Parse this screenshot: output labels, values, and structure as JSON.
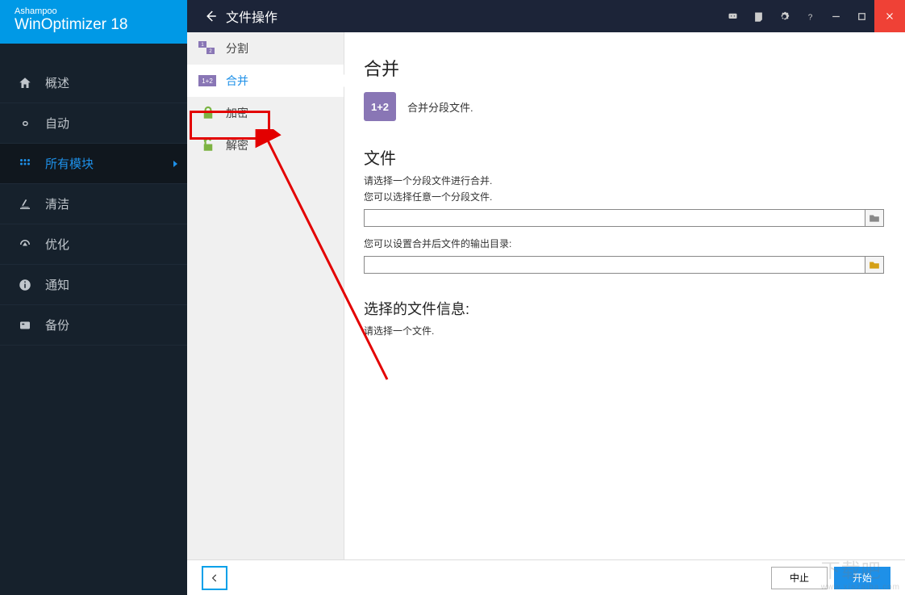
{
  "brand": {
    "small": "Ashampoo",
    "big": "WinOptimizer 18"
  },
  "titlebar": {
    "title": "文件操作"
  },
  "nav": [
    {
      "id": "overview",
      "label": "概述"
    },
    {
      "id": "auto",
      "label": "自动"
    },
    {
      "id": "modules",
      "label": "所有模块",
      "active": true
    },
    {
      "id": "clean",
      "label": "清洁"
    },
    {
      "id": "optimize",
      "label": "优化"
    },
    {
      "id": "notify",
      "label": "通知"
    },
    {
      "id": "backup",
      "label": "备份"
    }
  ],
  "subnav": [
    {
      "id": "split",
      "label": "分割"
    },
    {
      "id": "merge",
      "label": "合并",
      "selected": true
    },
    {
      "id": "encrypt",
      "label": "加密"
    },
    {
      "id": "decrypt",
      "label": "解密"
    }
  ],
  "main": {
    "heading": "合并",
    "badge": "1+2",
    "desc": "合并分段文件.",
    "file_section": "文件",
    "hint1": "请选择一个分段文件进行合并.",
    "hint2": "您可以选择任意一个分段文件.",
    "out_hint": "您可以设置合并后文件的输出目录:",
    "file_value": "",
    "out_value": "",
    "info_title": "选择的文件信息:",
    "info_hint": "请选择一个文件."
  },
  "footer": {
    "abort": "中止",
    "start": "开始"
  },
  "watermark": {
    "main": "下载吧",
    "sub": "www.xiazaiba.com"
  }
}
